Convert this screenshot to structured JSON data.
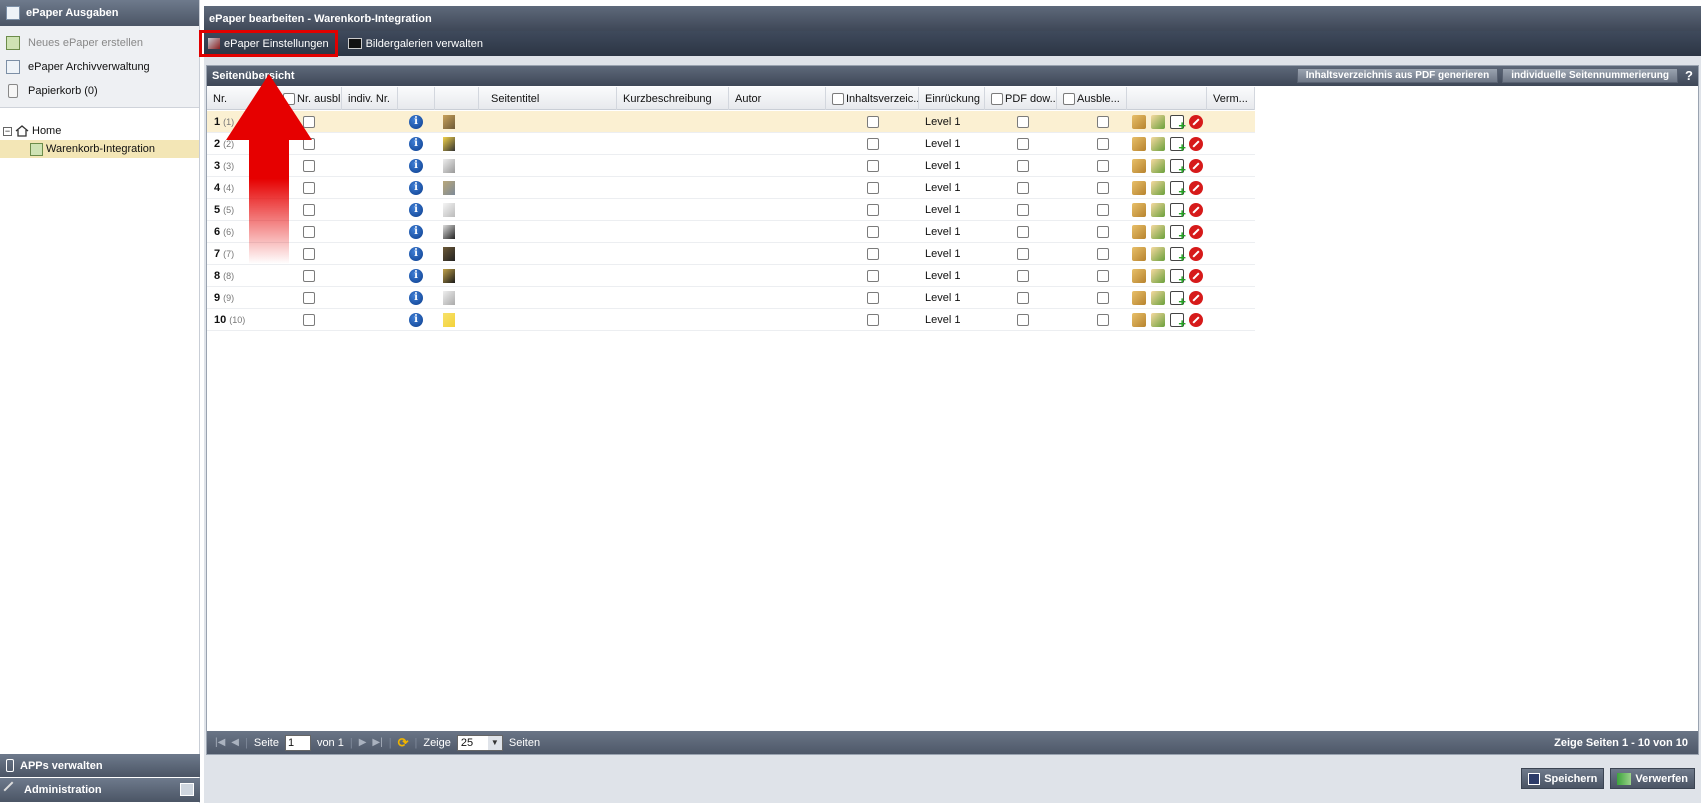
{
  "sidebar": {
    "title": "ePaper Ausgaben",
    "links": [
      {
        "label": "Neues ePaper erstellen",
        "icon": "new-document-icon",
        "disabled": true
      },
      {
        "label": "ePaper Archivverwaltung",
        "icon": "archive-icon",
        "disabled": false
      },
      {
        "label": "Papierkorb (0)",
        "icon": "trash-icon",
        "disabled": false
      }
    ],
    "tree": {
      "root": "Home",
      "child": "Warenkorb-Integration"
    },
    "bottom": [
      {
        "label": "APPs verwalten",
        "icon": "apps-icon"
      },
      {
        "label": "Administration",
        "icon": "tools-icon"
      }
    ]
  },
  "main": {
    "title": "ePaper bearbeiten - Warenkorb-Integration",
    "toolbar": {
      "settings_label": "ePaper Einstellungen",
      "galleries_label": "Bildergalerien verwalten"
    },
    "panel": {
      "title": "Seitenübersicht",
      "buttons": [
        "Inhaltsverzeichnis aus PDF generieren",
        "individuelle Seitennummerierung"
      ],
      "help_label": "?"
    }
  },
  "grid": {
    "columns": {
      "nr": "Nr.",
      "hide_nr": "Nr. ausbl...",
      "indiv_nr": "indiv. Nr.",
      "seitentitel": "Seitentitel",
      "kurzbeschreibung": "Kurzbeschreibung",
      "autor": "Autor",
      "toc": "Inhaltsverzeic...",
      "einrueckung": "Einrückung",
      "pdf": "PDF dow...",
      "ausblenden": "Ausble...",
      "verm": "Verm..."
    },
    "rows": [
      {
        "nr": "1",
        "sub": "(1)",
        "level": "Level 1"
      },
      {
        "nr": "2",
        "sub": "(2)",
        "level": "Level 1"
      },
      {
        "nr": "3",
        "sub": "(3)",
        "level": "Level 1"
      },
      {
        "nr": "4",
        "sub": "(4)",
        "level": "Level 1"
      },
      {
        "nr": "5",
        "sub": "(5)",
        "level": "Level 1"
      },
      {
        "nr": "6",
        "sub": "(6)",
        "level": "Level 1"
      },
      {
        "nr": "7",
        "sub": "(7)",
        "level": "Level 1"
      },
      {
        "nr": "8",
        "sub": "(8)",
        "level": "Level 1"
      },
      {
        "nr": "9",
        "sub": "(9)",
        "level": "Level 1"
      },
      {
        "nr": "10",
        "sub": "(10)",
        "level": "Level 1"
      }
    ]
  },
  "pager": {
    "page_label": "Seite",
    "page_value": "1",
    "of_label": "von 1",
    "show_label": "Zeige",
    "per_page": "25",
    "pages_label": "Seiten",
    "summary": "Zeige Seiten 1 - 10 von 10"
  },
  "footer": {
    "save_label": "Speichern",
    "discard_label": "Verwerfen"
  },
  "colors": {
    "highlight": "#e10000",
    "selected_row": "#fbf0d2",
    "header_dark": "#3e4757"
  }
}
